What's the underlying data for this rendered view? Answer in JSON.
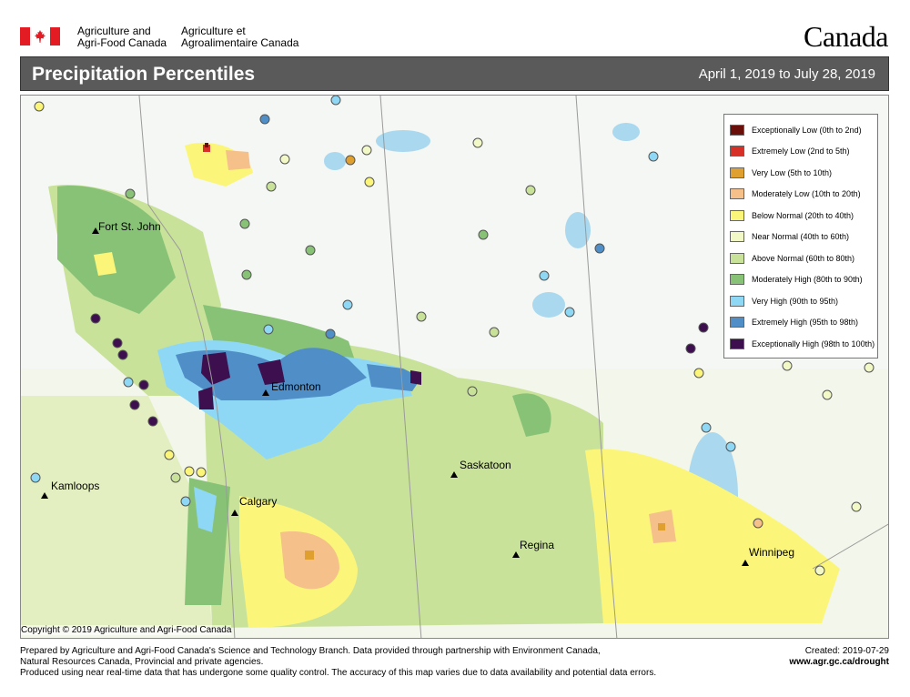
{
  "header": {
    "dept_en_line1": "Agriculture and",
    "dept_en_line2": "Agri-Food Canada",
    "dept_fr_line1": "Agriculture et",
    "dept_fr_line2": "Agroalimentaire Canada",
    "wordmark": "Canada"
  },
  "titlebar": {
    "title": "Precipitation Percentiles",
    "date_range": "April 1, 2019 to July 28, 2019"
  },
  "map": {
    "cities": [
      {
        "name": "Fort St. John"
      },
      {
        "name": "Edmonton"
      },
      {
        "name": "Kamloops"
      },
      {
        "name": "Calgary"
      },
      {
        "name": "Saskatoon"
      },
      {
        "name": "Regina"
      },
      {
        "name": "Winnipeg"
      }
    ],
    "copyright": "Copyright © 2019 Agriculture and Agri-Food Canada"
  },
  "legend": {
    "items": [
      {
        "label": "Exceptionally Low (0th to 2nd)",
        "color": "#6b0f0a"
      },
      {
        "label": "Extremely Low (2nd to 5th)",
        "color": "#d73027"
      },
      {
        "label": "Very Low (5th to 10th)",
        "color": "#e0a030"
      },
      {
        "label": "Moderately Low (10th to 20th)",
        "color": "#f5c08a"
      },
      {
        "label": "Below Normal (20th to 40th)",
        "color": "#fbf67a"
      },
      {
        "label": "Near Normal (40th to 60th)",
        "color": "#f2f8c6"
      },
      {
        "label": "Above Normal (60th to 80th)",
        "color": "#c9e29a"
      },
      {
        "label": "Moderately High (80th to 90th)",
        "color": "#88c277"
      },
      {
        "label": "Very High (90th to 95th)",
        "color": "#8fd8f5"
      },
      {
        "label": "Extremely High (95th to 98th)",
        "color": "#4f8ec7"
      },
      {
        "label": "Exceptionally High (98th to 100th)",
        "color": "#3d0f4f"
      }
    ]
  },
  "footer": {
    "line1": "Prepared by Agriculture and Agri-Food Canada's Science and Technology Branch. Data provided through partnership with Environment Canada,",
    "line2": "Natural Resources Canada, Provincial and private agencies.",
    "line3": "Produced using near real-time data that has undergone some quality control. The accuracy of this map varies due to data availability and potential data errors.",
    "created": "Created: 2019-07-29",
    "url": "www.agr.gc.ca/drought"
  }
}
